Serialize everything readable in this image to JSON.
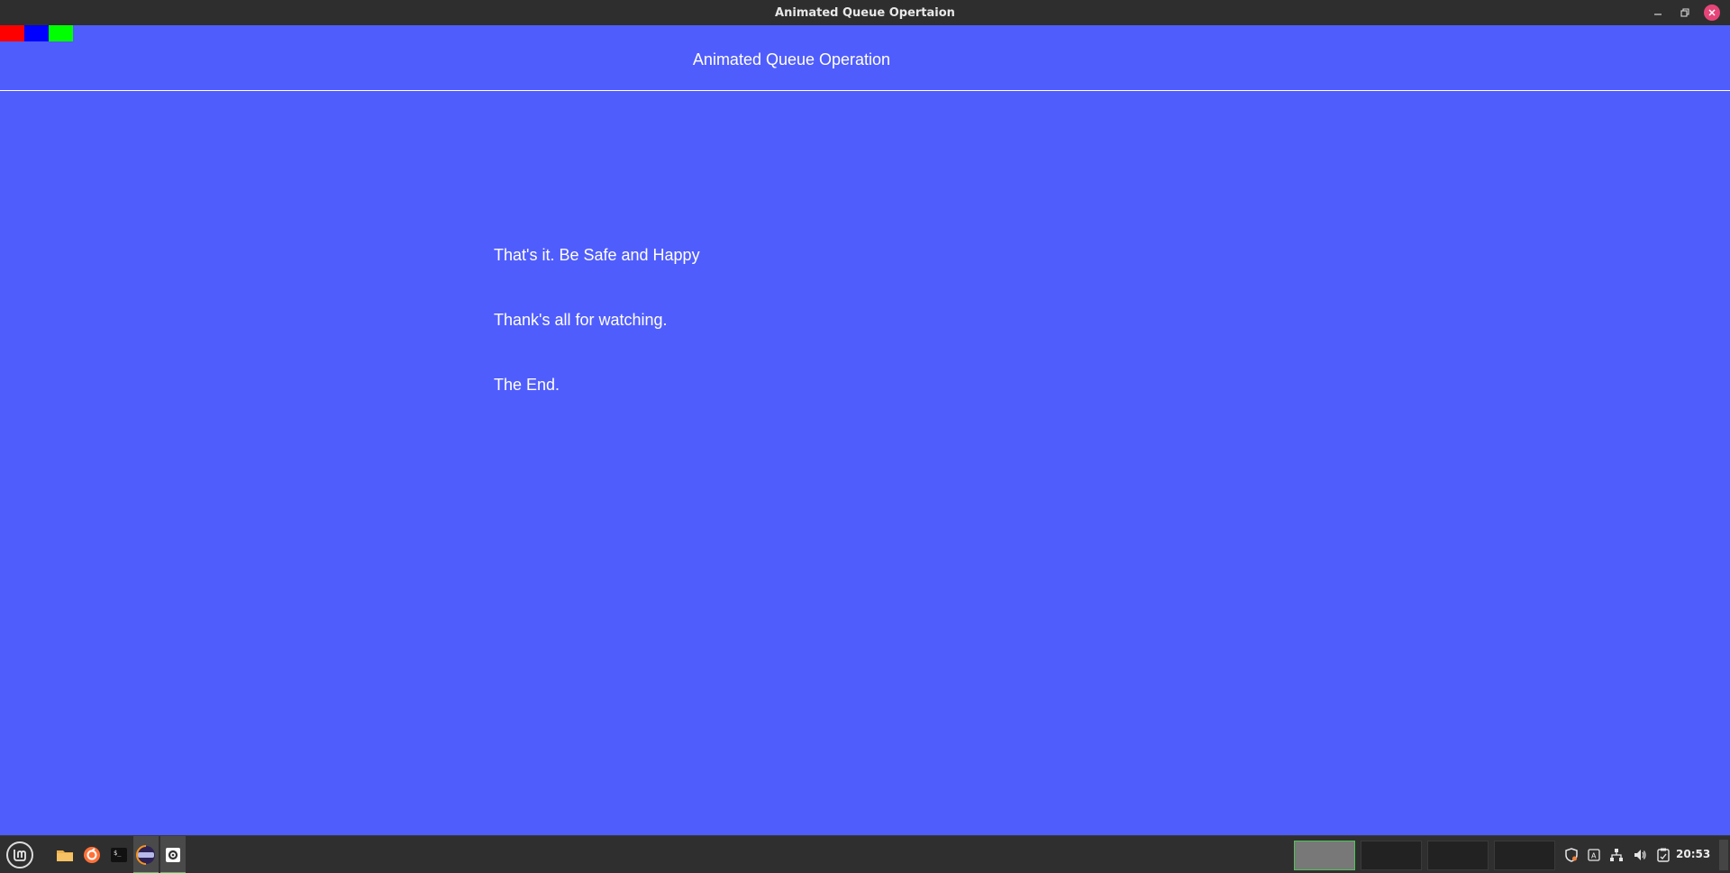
{
  "window": {
    "title": "Animated Queue Opertaion",
    "controls": {
      "minimize": "minimize-icon",
      "maximize": "maximize-icon",
      "close": "close-icon"
    }
  },
  "app": {
    "color_swatches": [
      "#ff0000",
      "#0000ff",
      "#00ff00"
    ],
    "background_color": "#505dfd",
    "header": "Animated Queue Operation",
    "messages": [
      "That's it. Be Safe and Happy",
      "Thank's all for watching.",
      "The End."
    ]
  },
  "taskbar": {
    "menu_icon": "linux-mint-menu-icon",
    "launchers": [
      {
        "name": "files-icon",
        "color": "#f0b04a"
      },
      {
        "name": "firefox-icon",
        "color": "#ff7139"
      },
      {
        "name": "terminal-icon",
        "color": "#111111"
      },
      {
        "name": "eclipse-icon",
        "color": "#8a8ac9"
      },
      {
        "name": "settings-icon",
        "color": "#ffffff"
      }
    ],
    "workspaces": [
      {
        "active": true
      },
      {
        "active": false
      },
      {
        "active": false
      },
      {
        "active": false
      }
    ],
    "tray_icons": [
      "shield-icon",
      "keyboard-icon",
      "network-icon",
      "volume-icon",
      "clipboard-icon"
    ],
    "clock": "20:53"
  }
}
